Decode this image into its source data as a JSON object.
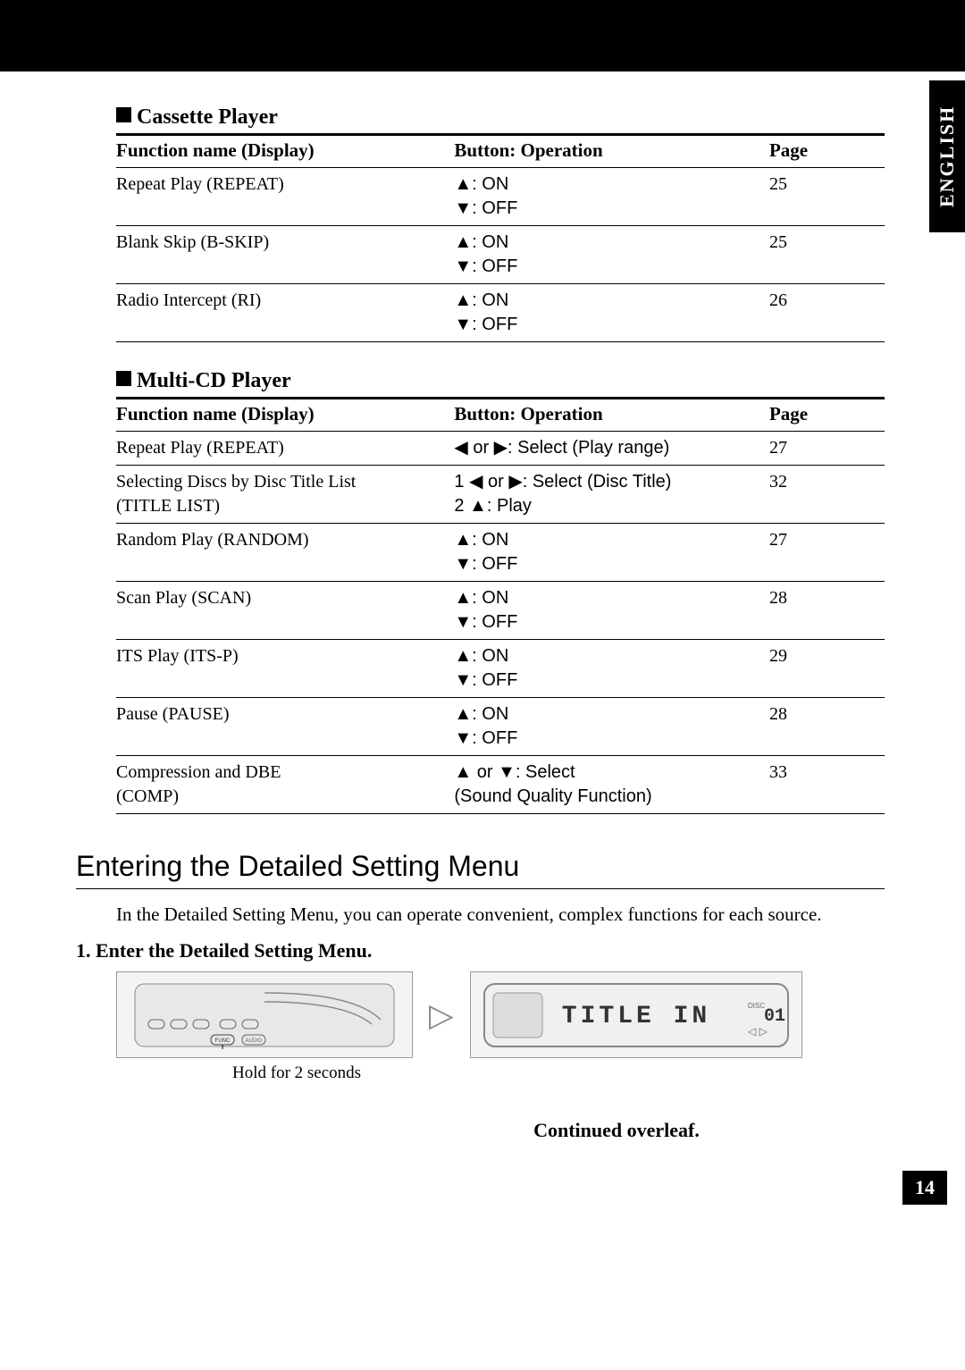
{
  "language_tab": "ENGLISH",
  "page_number": "14",
  "sections": [
    {
      "title": "Cassette Player",
      "headers": {
        "func": "Function name (Display)",
        "op": "Button: Operation",
        "page": "Page"
      },
      "rows": [
        {
          "func": "Repeat Play (REPEAT)",
          "op": "▲: ON\n▼: OFF",
          "page": "25"
        },
        {
          "func": "Blank Skip (B-SKIP)",
          "op": "▲: ON\n▼: OFF",
          "page": "25"
        },
        {
          "func": "Radio Intercept (RI)",
          "op": "▲: ON\n▼: OFF",
          "page": "26"
        }
      ]
    },
    {
      "title": "Multi-CD Player",
      "headers": {
        "func": "Function name (Display)",
        "op": "Button: Operation",
        "page": "Page"
      },
      "rows": [
        {
          "func": "Repeat Play (REPEAT)",
          "op": "◀ or ▶: Select (Play range)",
          "page": "27"
        },
        {
          "func": "Selecting Discs by Disc Title List\n(TITLE LIST)",
          "op": "1 ◀ or ▶: Select (Disc Title)\n2 ▲: Play",
          "page": "32"
        },
        {
          "func": "Random Play (RANDOM)",
          "op": "▲: ON\n▼: OFF",
          "page": "27"
        },
        {
          "func": "Scan Play (SCAN)",
          "op": "▲: ON\n▼: OFF",
          "page": "28"
        },
        {
          "func": "ITS Play (ITS-P)",
          "op": "▲: ON\n▼: OFF",
          "page": "29"
        },
        {
          "func": "Pause (PAUSE)",
          "op": "▲: ON\n▼: OFF",
          "page": "28"
        },
        {
          "func": "Compression and DBE\n(COMP)",
          "op": "▲ or ▼: Select\n(Sound Quality Function)",
          "page": "33"
        }
      ]
    }
  ],
  "big_heading": "Entering the Detailed Setting Menu",
  "body_text": "In the Detailed Setting Menu, you can operate convenient, complex functions for each source.",
  "step": {
    "number": "1.",
    "title": "Enter the Detailed Setting Menu.",
    "caption": "Hold for 2 seconds",
    "lcd_text": "TITLE IN",
    "lcd_disc": "01"
  },
  "continued": "Continued overleaf."
}
